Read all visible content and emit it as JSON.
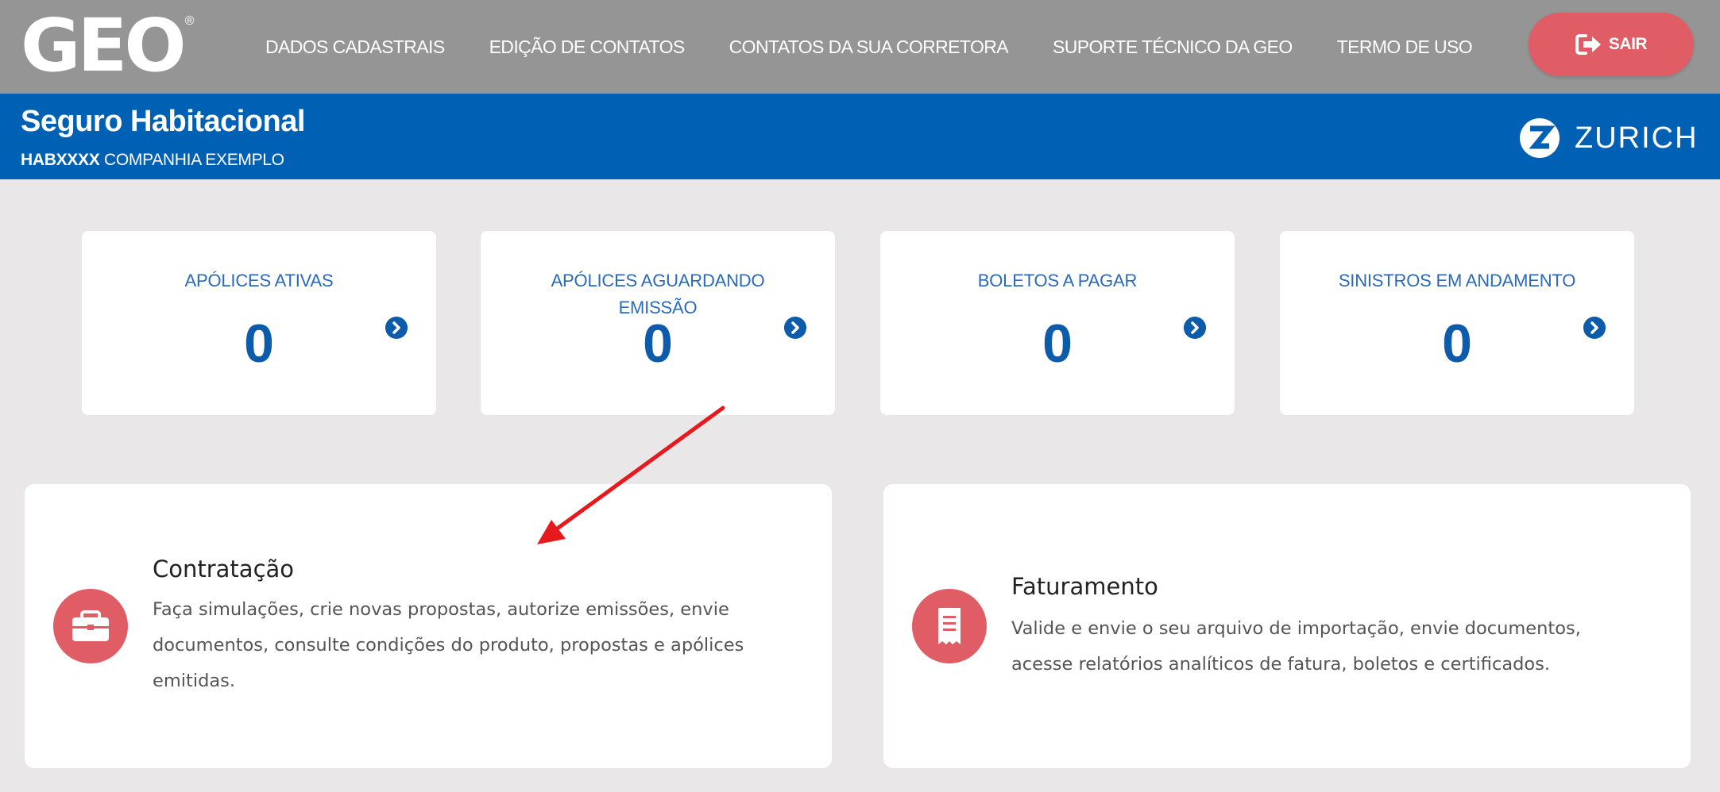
{
  "brand": {
    "logo_text": "GEO",
    "reg_mark": "®"
  },
  "nav": {
    "items": [
      "DADOS CADASTRAIS",
      "EDIÇÃO DE CONTATOS",
      "CONTATOS DA SUA CORRETORA",
      "SUPORTE TÉCNICO DA GEO",
      "TERMO DE USO"
    ],
    "logout_label": "SAIR",
    "logout_icon": "sign-out-icon"
  },
  "header": {
    "title": "Seguro Habitacional",
    "code": "HABXXXX",
    "company": "COMPANHIA EXEMPLO",
    "insurer": "ZURICH",
    "insurer_icon": "zurich-z-logo"
  },
  "stats": [
    {
      "label": "APÓLICES ATIVAS",
      "value": "0"
    },
    {
      "label": "APÓLICES AGUARDANDO EMISSÃO",
      "value": "0"
    },
    {
      "label": "BOLETOS A PAGAR",
      "value": "0"
    },
    {
      "label": "SINISTROS EM ANDAMENTO",
      "value": "0"
    }
  ],
  "services": {
    "contratacao": {
      "title": "Contratação",
      "desc1": "Faça simulações, crie novas propostas, autorize emissões, envie",
      "desc2": "documentos, consulte condições do produto, propostas e apólices",
      "desc3": "emitidas.",
      "icon": "briefcase-icon"
    },
    "faturamento": {
      "title": "Faturamento",
      "desc1": "Valide e envie o seu arquivo de importação, envie documentos,",
      "desc2": "acesse relatórios analíticos de fatura, boletos e certificados.",
      "icon": "receipt-icon"
    }
  },
  "colors": {
    "topbar": "#959595",
    "header_blue": "#0060b4",
    "accent_red": "#e05d65",
    "stat_blue": "#0d5cab",
    "background": "#e9e7e8",
    "annotation_arrow": "#e8191c"
  }
}
